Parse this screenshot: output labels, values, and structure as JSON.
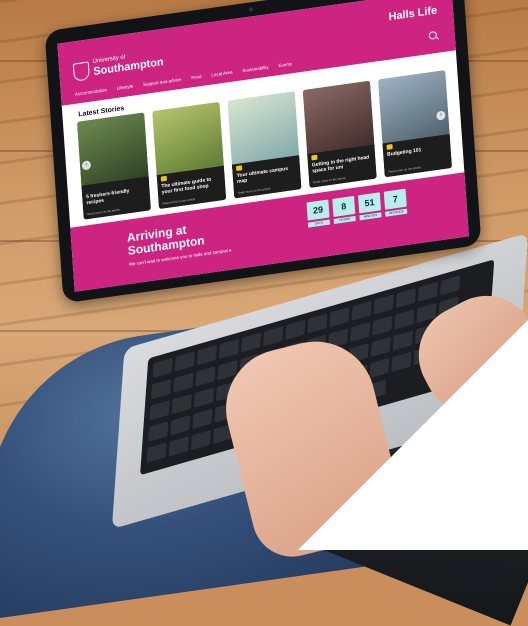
{
  "site": {
    "title": "Halls Life",
    "logo_small": "University of",
    "logo_big": "Southampton",
    "nav": [
      "Accommodation",
      "Lifestyle",
      "Support and advice",
      "Food",
      "Local Area",
      "Sustainability",
      "Events"
    ]
  },
  "stories": {
    "heading": "Latest Stories",
    "cards": [
      {
        "tag": "",
        "title": "5 freshers-friendly recipes",
        "meta": "Read more on the article",
        "image_color": "#4e6a3a",
        "tag_visible": false
      },
      {
        "tag": "",
        "title": "The ultimate guide to your first food shop",
        "meta": "Read more on the article",
        "image_color": "#8aa24a",
        "tag_visible": true
      },
      {
        "tag": "",
        "title": "Your ultimate campus map",
        "meta": "Read more on the article",
        "image_color": "#9cbfa2",
        "tag_visible": true
      },
      {
        "tag": "",
        "title": "Getting in the right head space for uni",
        "meta": "Read more on the article",
        "image_color": "#6d4a48",
        "tag_visible": true
      },
      {
        "tag": "",
        "title": "Budgeting 101",
        "meta": "Read more on the article",
        "image_color": "#7d8e9a",
        "tag_visible": true
      }
    ]
  },
  "arriving": {
    "title": "Arriving at Southampton",
    "text": "We can't wait to welcome you to halls and campus ▸",
    "countdown": [
      {
        "value": "29",
        "label": "DAYS"
      },
      {
        "value": "8",
        "label": "HOURS"
      },
      {
        "value": "51",
        "label": "MINUTES"
      },
      {
        "value": "7",
        "label": "SECONDS"
      }
    ]
  },
  "colors": {
    "brand": "#cc2480",
    "countdown": "#b9ecec"
  }
}
